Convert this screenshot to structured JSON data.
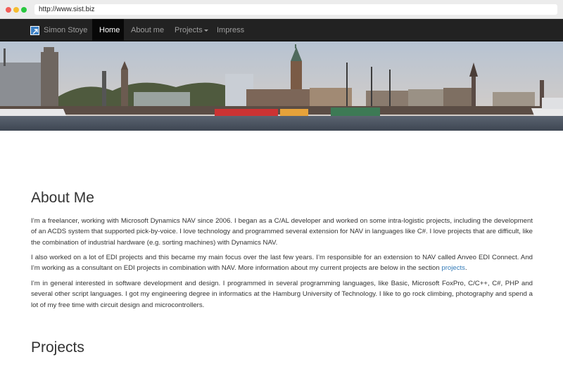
{
  "browser": {
    "url": "http://www.sist.biz"
  },
  "navbar": {
    "brand": "Simon Stoye",
    "items": [
      {
        "label": "Home",
        "active": true
      },
      {
        "label": "About me",
        "active": false
      },
      {
        "label": "Projects",
        "active": false,
        "dropdown": true
      },
      {
        "label": "Impress",
        "active": false
      }
    ]
  },
  "banner": {
    "icon": "harbor-skyline-image"
  },
  "about": {
    "heading": "About Me",
    "p1": "I’m a freelancer, working with Microsoft Dynamics NAV since 2006. I began as a C/AL developer and worked on some intra-logistic projects, including the development of an ACDS system that supported pick-by-voice. I love technology and programmed several extension for NAV in languages like C#. I love projects that are difficult, like the combination of industrial hardware (e.g. sorting machines) with Dynamics NAV.",
    "p2_text": "I also worked on a lot of EDI projects and this became my main focus over the last few years. I’m responsible for an extension to NAV called Anveo EDI Connect. And I’m working as a consultant on EDI projects in combination with NAV. More information about my current projects are below in the section ",
    "p2_link": "projects",
    "p2_end": ".",
    "p3": "I’m in general interested in software development and design. I programmed in several programming languages, like Basic, Microsoft FoxPro, C/C++, C#, PHP and several other script languages. I got my engineering degree in informatics at the Hamburg University of Technology. I like to go rock climbing, photography and spend a lot of my free time with circuit design and microcontrollers."
  },
  "projects": {
    "heading": "Projects"
  },
  "colors": {
    "navbar_bg": "#222222",
    "link": "#337ab7",
    "text": "#333333"
  }
}
